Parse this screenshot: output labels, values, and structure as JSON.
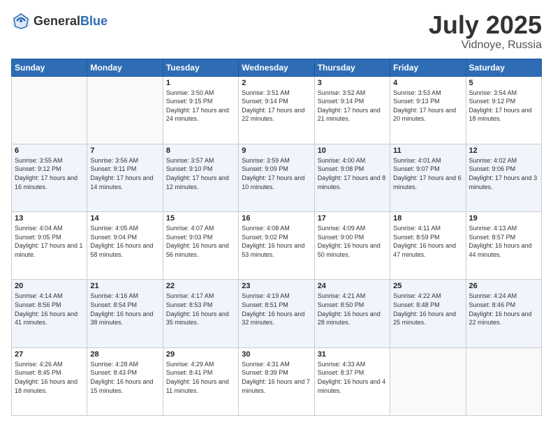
{
  "header": {
    "logo_general": "General",
    "logo_blue": "Blue",
    "month": "July 2025",
    "location": "Vidnoye, Russia"
  },
  "weekdays": [
    "Sunday",
    "Monday",
    "Tuesday",
    "Wednesday",
    "Thursday",
    "Friday",
    "Saturday"
  ],
  "weeks": [
    [
      {
        "day": "",
        "sunrise": "",
        "sunset": "",
        "daylight": ""
      },
      {
        "day": "",
        "sunrise": "",
        "sunset": "",
        "daylight": ""
      },
      {
        "day": "1",
        "sunrise": "Sunrise: 3:50 AM",
        "sunset": "Sunset: 9:15 PM",
        "daylight": "Daylight: 17 hours and 24 minutes."
      },
      {
        "day": "2",
        "sunrise": "Sunrise: 3:51 AM",
        "sunset": "Sunset: 9:14 PM",
        "daylight": "Daylight: 17 hours and 22 minutes."
      },
      {
        "day": "3",
        "sunrise": "Sunrise: 3:52 AM",
        "sunset": "Sunset: 9:14 PM",
        "daylight": "Daylight: 17 hours and 21 minutes."
      },
      {
        "day": "4",
        "sunrise": "Sunrise: 3:53 AM",
        "sunset": "Sunset: 9:13 PM",
        "daylight": "Daylight: 17 hours and 20 minutes."
      },
      {
        "day": "5",
        "sunrise": "Sunrise: 3:54 AM",
        "sunset": "Sunset: 9:12 PM",
        "daylight": "Daylight: 17 hours and 18 minutes."
      }
    ],
    [
      {
        "day": "6",
        "sunrise": "Sunrise: 3:55 AM",
        "sunset": "Sunset: 9:12 PM",
        "daylight": "Daylight: 17 hours and 16 minutes."
      },
      {
        "day": "7",
        "sunrise": "Sunrise: 3:56 AM",
        "sunset": "Sunset: 9:11 PM",
        "daylight": "Daylight: 17 hours and 14 minutes."
      },
      {
        "day": "8",
        "sunrise": "Sunrise: 3:57 AM",
        "sunset": "Sunset: 9:10 PM",
        "daylight": "Daylight: 17 hours and 12 minutes."
      },
      {
        "day": "9",
        "sunrise": "Sunrise: 3:59 AM",
        "sunset": "Sunset: 9:09 PM",
        "daylight": "Daylight: 17 hours and 10 minutes."
      },
      {
        "day": "10",
        "sunrise": "Sunrise: 4:00 AM",
        "sunset": "Sunset: 9:08 PM",
        "daylight": "Daylight: 17 hours and 8 minutes."
      },
      {
        "day": "11",
        "sunrise": "Sunrise: 4:01 AM",
        "sunset": "Sunset: 9:07 PM",
        "daylight": "Daylight: 17 hours and 6 minutes."
      },
      {
        "day": "12",
        "sunrise": "Sunrise: 4:02 AM",
        "sunset": "Sunset: 9:06 PM",
        "daylight": "Daylight: 17 hours and 3 minutes."
      }
    ],
    [
      {
        "day": "13",
        "sunrise": "Sunrise: 4:04 AM",
        "sunset": "Sunset: 9:05 PM",
        "daylight": "Daylight: 17 hours and 1 minute."
      },
      {
        "day": "14",
        "sunrise": "Sunrise: 4:05 AM",
        "sunset": "Sunset: 9:04 PM",
        "daylight": "Daylight: 16 hours and 58 minutes."
      },
      {
        "day": "15",
        "sunrise": "Sunrise: 4:07 AM",
        "sunset": "Sunset: 9:03 PM",
        "daylight": "Daylight: 16 hours and 56 minutes."
      },
      {
        "day": "16",
        "sunrise": "Sunrise: 4:08 AM",
        "sunset": "Sunset: 9:02 PM",
        "daylight": "Daylight: 16 hours and 53 minutes."
      },
      {
        "day": "17",
        "sunrise": "Sunrise: 4:09 AM",
        "sunset": "Sunset: 9:00 PM",
        "daylight": "Daylight: 16 hours and 50 minutes."
      },
      {
        "day": "18",
        "sunrise": "Sunrise: 4:11 AM",
        "sunset": "Sunset: 8:59 PM",
        "daylight": "Daylight: 16 hours and 47 minutes."
      },
      {
        "day": "19",
        "sunrise": "Sunrise: 4:13 AM",
        "sunset": "Sunset: 8:57 PM",
        "daylight": "Daylight: 16 hours and 44 minutes."
      }
    ],
    [
      {
        "day": "20",
        "sunrise": "Sunrise: 4:14 AM",
        "sunset": "Sunset: 8:56 PM",
        "daylight": "Daylight: 16 hours and 41 minutes."
      },
      {
        "day": "21",
        "sunrise": "Sunrise: 4:16 AM",
        "sunset": "Sunset: 8:54 PM",
        "daylight": "Daylight: 16 hours and 38 minutes."
      },
      {
        "day": "22",
        "sunrise": "Sunrise: 4:17 AM",
        "sunset": "Sunset: 8:53 PM",
        "daylight": "Daylight: 16 hours and 35 minutes."
      },
      {
        "day": "23",
        "sunrise": "Sunrise: 4:19 AM",
        "sunset": "Sunset: 8:51 PM",
        "daylight": "Daylight: 16 hours and 32 minutes."
      },
      {
        "day": "24",
        "sunrise": "Sunrise: 4:21 AM",
        "sunset": "Sunset: 8:50 PM",
        "daylight": "Daylight: 16 hours and 28 minutes."
      },
      {
        "day": "25",
        "sunrise": "Sunrise: 4:22 AM",
        "sunset": "Sunset: 8:48 PM",
        "daylight": "Daylight: 16 hours and 25 minutes."
      },
      {
        "day": "26",
        "sunrise": "Sunrise: 4:24 AM",
        "sunset": "Sunset: 8:46 PM",
        "daylight": "Daylight: 16 hours and 22 minutes."
      }
    ],
    [
      {
        "day": "27",
        "sunrise": "Sunrise: 4:26 AM",
        "sunset": "Sunset: 8:45 PM",
        "daylight": "Daylight: 16 hours and 18 minutes."
      },
      {
        "day": "28",
        "sunrise": "Sunrise: 4:28 AM",
        "sunset": "Sunset: 8:43 PM",
        "daylight": "Daylight: 16 hours and 15 minutes."
      },
      {
        "day": "29",
        "sunrise": "Sunrise: 4:29 AM",
        "sunset": "Sunset: 8:41 PM",
        "daylight": "Daylight: 16 hours and 11 minutes."
      },
      {
        "day": "30",
        "sunrise": "Sunrise: 4:31 AM",
        "sunset": "Sunset: 8:39 PM",
        "daylight": "Daylight: 16 hours and 7 minutes."
      },
      {
        "day": "31",
        "sunrise": "Sunrise: 4:33 AM",
        "sunset": "Sunset: 8:37 PM",
        "daylight": "Daylight: 16 hours and 4 minutes."
      },
      {
        "day": "",
        "sunrise": "",
        "sunset": "",
        "daylight": ""
      },
      {
        "day": "",
        "sunrise": "",
        "sunset": "",
        "daylight": ""
      }
    ]
  ]
}
